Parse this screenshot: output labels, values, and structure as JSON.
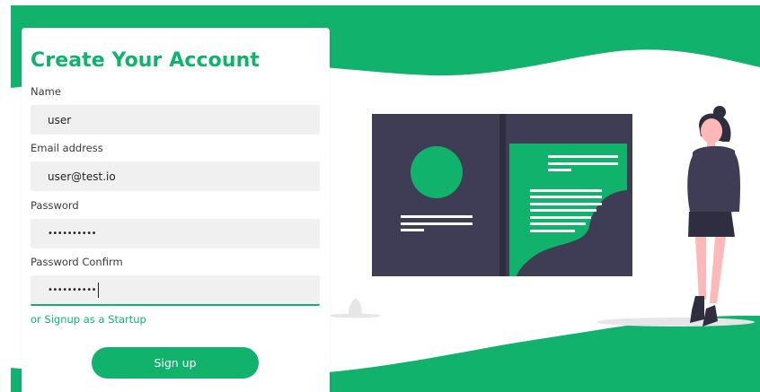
{
  "form": {
    "title": "Create Your Account",
    "name_label": "Name",
    "name_value": "user",
    "email_label": "Email address",
    "email_value": "user@test.io",
    "password_label": "Password",
    "password_value": "••••••••••",
    "password_confirm_label": "Password Confirm",
    "password_confirm_value": "••••••••••",
    "alt_link": "or Signup as a Startup",
    "submit_label": "Sign up"
  },
  "colors": {
    "accent": "#10b26c",
    "illustration_dark": "#3f3d56",
    "skin": "#ffb8b8",
    "shadow": "#e6e6e6"
  }
}
